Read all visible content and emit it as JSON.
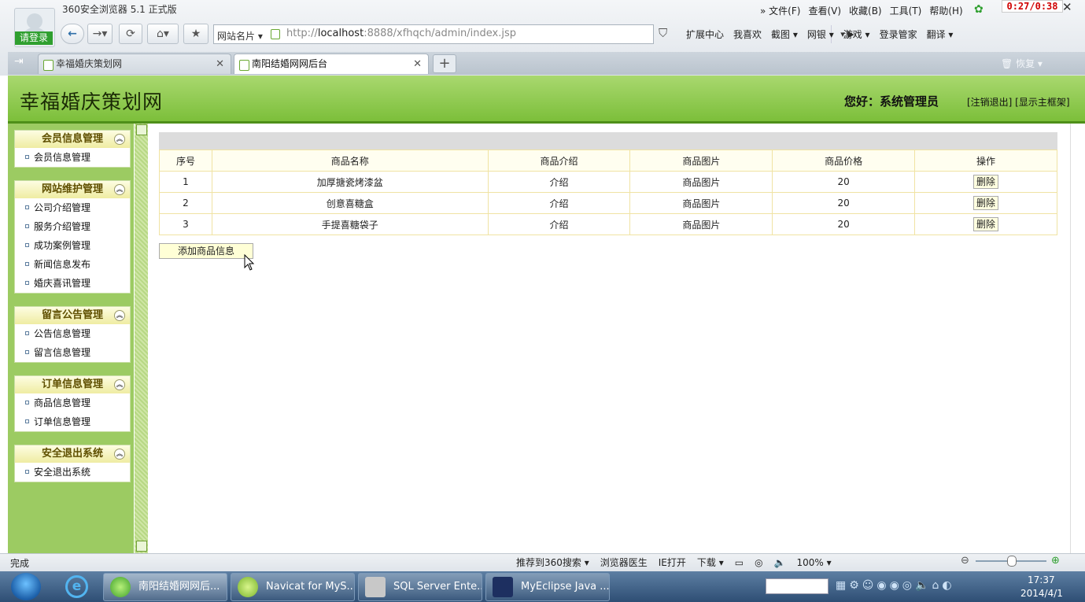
{
  "browser": {
    "app_title": "360安全浏览器 5.1 正式版",
    "login_label": "请登录",
    "timer": "0:27/0:38",
    "menus": [
      "» 文件(F)",
      "查看(V)",
      "收藏(B)",
      "工具(T)",
      "帮助(H)"
    ],
    "address_prefix": "网站名片 ▾",
    "address_scheme": "http://",
    "address_host": "localhost",
    "address_rest": ":8888/xfhqch/admin/index.jsp",
    "toolbar_items": [
      "扩展中心",
      "我喜欢",
      "截图 ▾",
      "网银 ▾",
      "游戏 ▾",
      "登录管家",
      "翻译 ▾"
    ],
    "tabs": [
      {
        "label": "幸福婚庆策划网"
      },
      {
        "label": "南阳结婚网网后台"
      }
    ],
    "restore_label": "恢复 ▾"
  },
  "header": {
    "site_title": "幸福婚庆策划网",
    "greeting": "您好：系统管理员",
    "links": "[注销退出] [显示主框架]"
  },
  "sidebar": {
    "groups": [
      {
        "title": "会员信息管理",
        "items": [
          "会员信息管理"
        ]
      },
      {
        "title": "网站维护管理",
        "items": [
          "公司介绍管理",
          "服务介绍管理",
          "成功案例管理",
          "新闻信息发布",
          "婚庆喜讯管理"
        ]
      },
      {
        "title": "留言公告管理",
        "items": [
          "公告信息管理",
          "留言信息管理"
        ]
      },
      {
        "title": "订单信息管理",
        "items": [
          "商品信息管理",
          "订单信息管理"
        ]
      },
      {
        "title": "安全退出系统",
        "items": [
          "安全退出系统"
        ]
      }
    ]
  },
  "table": {
    "headers": [
      "序号",
      "商品名称",
      "商品介绍",
      "商品图片",
      "商品价格",
      "操作"
    ],
    "rows": [
      {
        "no": "1",
        "name": "加厚搪瓷烤漆盆",
        "intro": "介绍",
        "image": "商品图片",
        "price": "20",
        "action": "删除"
      },
      {
        "no": "2",
        "name": "创意喜糖盒",
        "intro": "介绍",
        "image": "商品图片",
        "price": "20",
        "action": "删除"
      },
      {
        "no": "3",
        "name": "手提喜糖袋子",
        "intro": "介绍",
        "image": "商品图片",
        "price": "20",
        "action": "删除"
      }
    ],
    "add_button": "添加商品信息"
  },
  "status": {
    "text": "完成",
    "tools": [
      "推荐到360搜索 ▾",
      "浏览器医生",
      "IE打开",
      "下载 ▾"
    ],
    "zoom": "100% ▾"
  },
  "taskbar": {
    "tasks": [
      "南阳结婚网网后...",
      "Navicat for MyS...",
      "SQL Server Ente...",
      "MyEclipse Java ..."
    ],
    "time": "17:37",
    "date": "2014/4/1"
  },
  "colors": {
    "header_green": "#7cbf3a",
    "sidebar_green": "#9ccb62",
    "menu_head_yellow": "#efeca2",
    "table_border": "#f0e3a3"
  }
}
